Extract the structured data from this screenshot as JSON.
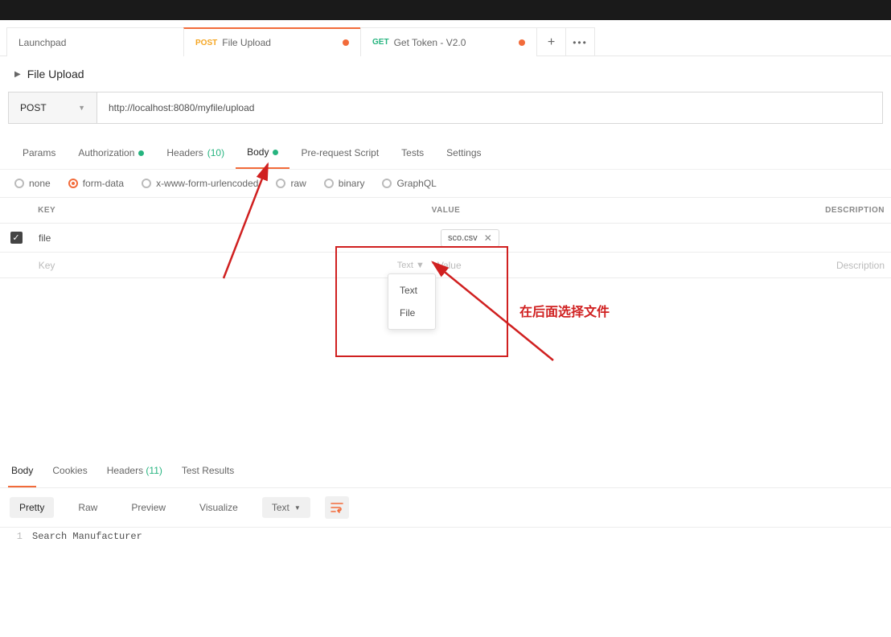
{
  "tabs": [
    {
      "label": "Launchpad",
      "method": ""
    },
    {
      "method": "POST",
      "label": "File Upload",
      "dirty": true
    },
    {
      "method": "GET",
      "label": "Get Token - V2.0",
      "dirty": true
    }
  ],
  "breadcrumb": {
    "title": "File Upload"
  },
  "request": {
    "method": "POST",
    "url": "http://localhost:8080/myfile/upload"
  },
  "req_tabs": {
    "params": "Params",
    "auth": "Authorization",
    "headers_label": "Headers",
    "headers_count": "(10)",
    "body": "Body",
    "prereq": "Pre-request Script",
    "tests": "Tests",
    "settings": "Settings"
  },
  "body_types": {
    "none": "none",
    "formdata": "form-data",
    "xwww": "x-www-form-urlencoded",
    "raw": "raw",
    "binary": "binary",
    "graphql": "GraphQL"
  },
  "kv": {
    "headers": {
      "key": "KEY",
      "value": "VALUE",
      "desc": "DESCRIPTION"
    },
    "row1": {
      "key": "file",
      "file": "sco.csv"
    },
    "placeholders": {
      "key": "Key",
      "value": "Value",
      "desc": "Description",
      "type": "Text"
    },
    "dropdown": {
      "text": "Text",
      "file": "File"
    }
  },
  "annotation": {
    "text": "在后面选择文件"
  },
  "resp_tabs": {
    "body": "Body",
    "cookies": "Cookies",
    "headers_label": "Headers",
    "headers_count": "(11)",
    "tests": "Test Results"
  },
  "resp_toolbar": {
    "pretty": "Pretty",
    "raw": "Raw",
    "preview": "Preview",
    "visualize": "Visualize",
    "format": "Text"
  },
  "resp_body": {
    "lineno": "1",
    "content": "Search Manufacturer"
  }
}
